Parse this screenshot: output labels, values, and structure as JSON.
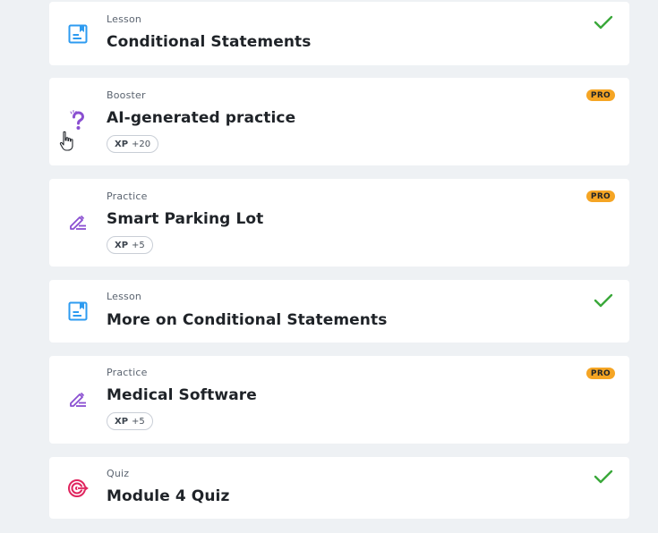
{
  "items": [
    {
      "type": "Lesson",
      "title": "Conditional Statements",
      "status": "completed",
      "icon": "lesson-icon"
    },
    {
      "type": "Booster",
      "title": "AI-generated practice",
      "badge": "PRO",
      "xp_label": "XP",
      "xp_value": "+20",
      "icon": "question-icon"
    },
    {
      "type": "Practice",
      "title": "Smart Parking Lot",
      "badge": "PRO",
      "xp_label": "XP",
      "xp_value": "+5",
      "icon": "pencil-icon"
    },
    {
      "type": "Lesson",
      "title": "More on Conditional Statements",
      "status": "completed",
      "icon": "lesson-icon"
    },
    {
      "type": "Practice",
      "title": "Medical Software",
      "badge": "PRO",
      "xp_label": "XP",
      "xp_value": "+5",
      "icon": "pencil-icon"
    },
    {
      "type": "Quiz",
      "title": "Module 4 Quiz",
      "status": "completed",
      "icon": "target-icon"
    }
  ],
  "colors": {
    "background": "#eef1f4",
    "card": "#ffffff",
    "check": "#3aa83a",
    "pro_badge": "#f5a524",
    "lesson_icon": "#2d9bf0",
    "practice_icon": "#8a4fd1",
    "quiz_icon": "#e0245e"
  }
}
